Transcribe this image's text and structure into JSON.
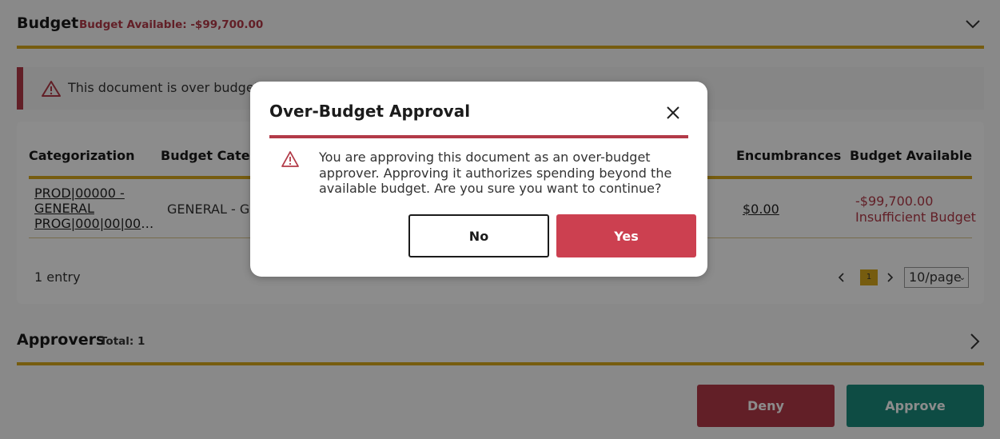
{
  "budget": {
    "title": "Budget",
    "available_label": "Budget Available: -$99,700.00"
  },
  "alert": {
    "text": "This document is over budget. Re"
  },
  "table": {
    "headers": [
      "Categorization",
      "Budget Categor",
      "Encumbrances",
      "Budget Available"
    ],
    "row": {
      "categorization_lines": [
        "PROD|00000 -",
        "GENERAL",
        "PROG|000|00|000..."
      ],
      "budget_category": "GENERAL - Ge",
      "encumbrances": "$0.00",
      "budget_available": "-$99,700.00",
      "budget_status": "Insufficient Budget"
    },
    "entries": "1 entry",
    "pager": {
      "current_page": "1",
      "page_size": "10/page"
    }
  },
  "approvers": {
    "title": "Approvers",
    "total": "Total: 1"
  },
  "actions": {
    "deny": "Deny",
    "approve": "Approve"
  },
  "modal": {
    "title": "Over-Budget Approval",
    "message": "You are approving this document as an over-budget approver. Approving it authorizes spending beyond the available budget. Are you sure you want to continue?",
    "no_label": "No",
    "yes_label": "Yes"
  },
  "colors": {
    "gold": "#d7a81d",
    "danger": "#b23a48",
    "approve": "#1a8b7c"
  },
  "icons": [
    "chevron-down-icon",
    "warning-icon",
    "chevron-left-icon",
    "chevron-right-icon",
    "close-icon",
    "caret-down-icon"
  ]
}
